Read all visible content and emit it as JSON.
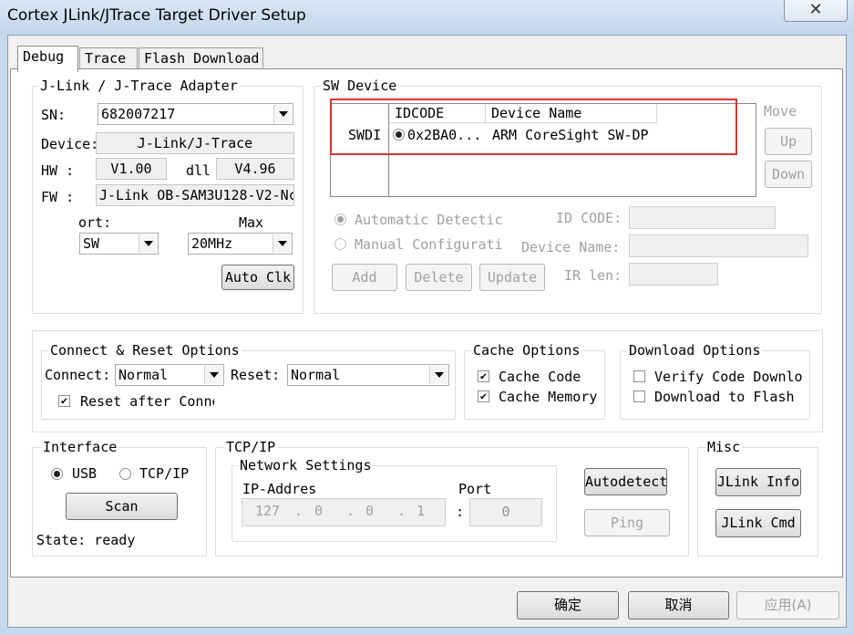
{
  "window": {
    "title": "Cortex JLink/JTrace Target Driver Setup"
  },
  "tabs": [
    {
      "label": "Debug"
    },
    {
      "label": "Trace"
    },
    {
      "label": "Flash Download"
    }
  ],
  "adapter": {
    "legend": "J-Link / J-Trace Adapter",
    "sn_label": "SN:",
    "sn_value": "682007217",
    "device_label": "Device:",
    "device_value": "J-Link/J-Trace",
    "hw_label": "HW :",
    "hw_value": "V1.00",
    "dll_label": "dll",
    "dll_value": "V4.96",
    "fw_label": "FW :",
    "fw_value": "J-Link OB-SAM3U128-V2-Nc",
    "port_label": "ort:",
    "port_value": "SW",
    "max_label": "Max",
    "max_value": "20MHz",
    "auto_clk": "Auto Clk"
  },
  "sw_device": {
    "legend": "SW Device",
    "row_label": "SWDI",
    "columns": [
      "IDCODE",
      "Device Name"
    ],
    "rows": [
      {
        "idcode": "0x2BA0...",
        "device_name": "ARM CoreSight SW-DP"
      }
    ],
    "move_label": "Move",
    "up": "Up",
    "down": "Down",
    "auto_detect": "Automatic Detectic",
    "manual_config": "Manual Configurati",
    "id_code_label": "ID CODE:",
    "device_name_label": "Device Name:",
    "ir_len_label": "IR len:",
    "add": "Add",
    "delete": "Delete",
    "update": "Update"
  },
  "connect_reset": {
    "legend": "Connect & Reset Options",
    "connect_label": "Connect:",
    "connect_value": "Normal",
    "reset_label": "Reset:",
    "reset_value": "Normal",
    "reset_after_connect": "Reset after Conne"
  },
  "cache": {
    "legend": "Cache Options",
    "cache_code": "Cache Code",
    "cache_memory": "Cache Memory"
  },
  "download": {
    "legend": "Download Options",
    "verify": "Verify Code Downlo",
    "download_flash": "Download to Flash"
  },
  "interface": {
    "legend": "Interface",
    "usb": "USB",
    "tcpip": "TCP/IP",
    "scan": "Scan",
    "state": "State: ready"
  },
  "tcpip": {
    "legend": "TCP/IP",
    "network_legend": "Network Settings",
    "ip_label": "IP-Addres",
    "port_label": "Port",
    "ip_octets": [
      "127",
      "0",
      "0",
      "1"
    ],
    "port_value": "0",
    "autodetect": "Autodetect",
    "ping": "Ping"
  },
  "misc": {
    "legend": "Misc",
    "jlink_info": "JLink Info",
    "jlink_cmd": "JLink Cmd"
  },
  "footer": {
    "ok": "确定",
    "cancel": "取消",
    "apply": "应用(A)"
  },
  "annotation_color": "#e03030"
}
